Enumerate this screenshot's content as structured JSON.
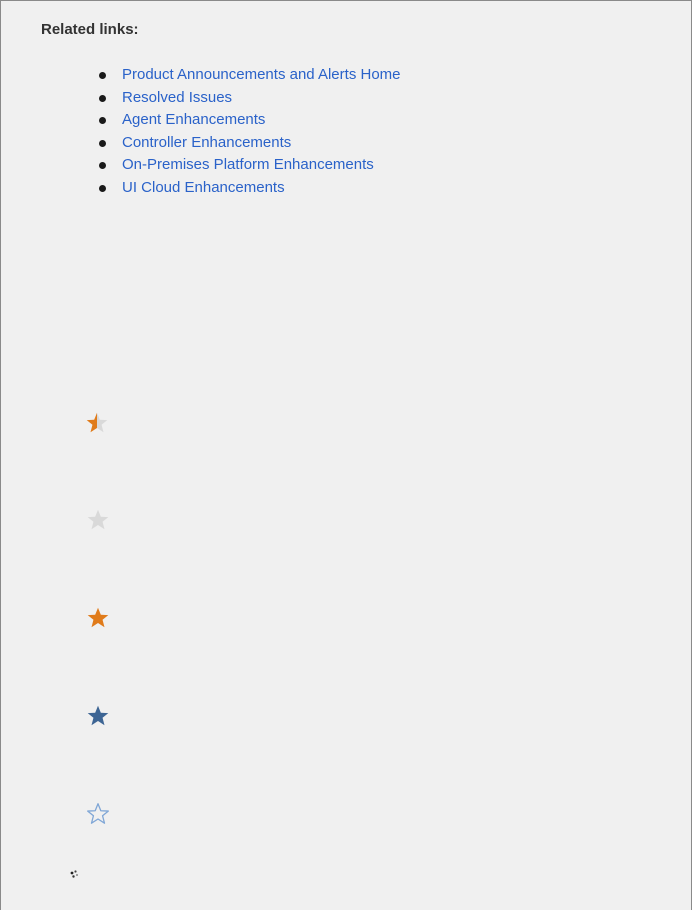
{
  "section": {
    "heading": "Related links:"
  },
  "links": [
    {
      "label": "Product Announcements and Alerts Home"
    },
    {
      "label": "Resolved Issues"
    },
    {
      "label": "Agent Enhancements"
    },
    {
      "label": "Controller Enhancements"
    },
    {
      "label": "On-Premises Platform Enhancements"
    },
    {
      "label": "UI Cloud Enhancements"
    }
  ],
  "rating_icons": [
    {
      "name": "half-star-icon",
      "fill_fraction": 0.5,
      "color": "#e07b1a",
      "empty_color": "#d9d9d9"
    },
    {
      "name": "grey-star-icon",
      "color": "#d9d9d9"
    },
    {
      "name": "orange-star-icon",
      "color": "#e07b1a"
    },
    {
      "name": "blue-star-icon",
      "color": "#3d6594"
    },
    {
      "name": "outline-star-icon",
      "color": "#7fa6d6"
    }
  ],
  "colors": {
    "link": "#2a62c9",
    "panel_background": "#f0f0f0",
    "panel_border": "#8a8a8a"
  }
}
